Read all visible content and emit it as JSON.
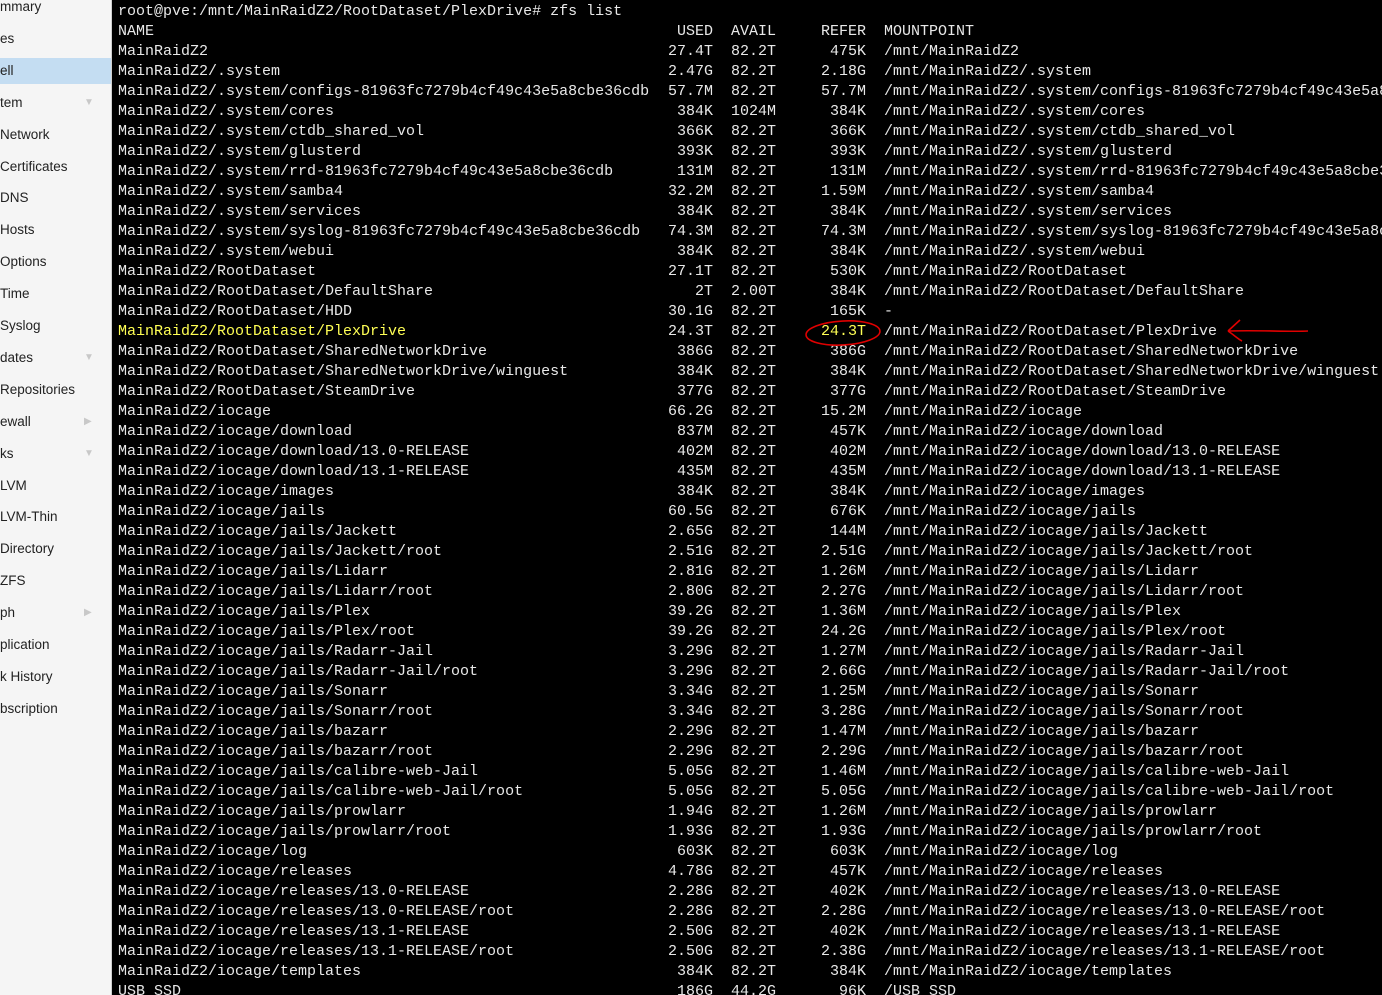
{
  "sidebar": {
    "items": [
      {
        "label": "mmary",
        "arrow": ""
      },
      {
        "label": "es",
        "arrow": ""
      },
      {
        "label": "ell",
        "arrow": "",
        "selected": true
      },
      {
        "label": "tem",
        "arrow": "▼"
      },
      {
        "label": "Network",
        "arrow": ""
      },
      {
        "label": "Certificates",
        "arrow": ""
      },
      {
        "label": "DNS",
        "arrow": ""
      },
      {
        "label": "Hosts",
        "arrow": ""
      },
      {
        "label": "Options",
        "arrow": ""
      },
      {
        "label": "Time",
        "arrow": ""
      },
      {
        "label": "Syslog",
        "arrow": ""
      },
      {
        "label": "dates",
        "arrow": "▼"
      },
      {
        "label": "Repositories",
        "arrow": ""
      },
      {
        "label": "ewall",
        "arrow": "▶"
      },
      {
        "label": "ks",
        "arrow": "▼"
      },
      {
        "label": "LVM",
        "arrow": ""
      },
      {
        "label": "LVM-Thin",
        "arrow": ""
      },
      {
        "label": "Directory",
        "arrow": ""
      },
      {
        "label": "ZFS",
        "arrow": ""
      },
      {
        "label": "ph",
        "arrow": "▶"
      },
      {
        "label": "plication",
        "arrow": ""
      },
      {
        "label": "k History",
        "arrow": ""
      },
      {
        "label": "bscription",
        "arrow": ""
      }
    ]
  },
  "terminal": {
    "prompt": "root@pve:/mnt/MainRaidZ2/RootDataset/PlexDrive# zfs list",
    "headers": {
      "name": "NAME",
      "used": "USED",
      "avail": "AVAIL",
      "refer": "REFER",
      "mount": "MOUNTPOINT"
    },
    "highlight_color": "#ffff55",
    "annotation_color": "#e00000",
    "rows": [
      [
        "MainRaidZ2",
        "27.4T",
        "82.2T",
        "475K",
        "/mnt/MainRaidZ2"
      ],
      [
        "MainRaidZ2/.system",
        "2.47G",
        "82.2T",
        "2.18G",
        "/mnt/MainRaidZ2/.system"
      ],
      [
        "MainRaidZ2/.system/configs-81963fc7279b4cf49c43e5a8cbe36cdb",
        "57.7M",
        "82.2T",
        "57.7M",
        "/mnt/MainRaidZ2/.system/configs-81963fc7279b4cf49c43e5a8"
      ],
      [
        "MainRaidZ2/.system/cores",
        "384K",
        "1024M",
        "384K",
        "/mnt/MainRaidZ2/.system/cores"
      ],
      [
        "MainRaidZ2/.system/ctdb_shared_vol",
        "366K",
        "82.2T",
        "366K",
        "/mnt/MainRaidZ2/.system/ctdb_shared_vol"
      ],
      [
        "MainRaidZ2/.system/glusterd",
        "393K",
        "82.2T",
        "393K",
        "/mnt/MainRaidZ2/.system/glusterd"
      ],
      [
        "MainRaidZ2/.system/rrd-81963fc7279b4cf49c43e5a8cbe36cdb",
        "131M",
        "82.2T",
        "131M",
        "/mnt/MainRaidZ2/.system/rrd-81963fc7279b4cf49c43e5a8cbe3"
      ],
      [
        "MainRaidZ2/.system/samba4",
        "32.2M",
        "82.2T",
        "1.59M",
        "/mnt/MainRaidZ2/.system/samba4"
      ],
      [
        "MainRaidZ2/.system/services",
        "384K",
        "82.2T",
        "384K",
        "/mnt/MainRaidZ2/.system/services"
      ],
      [
        "MainRaidZ2/.system/syslog-81963fc7279b4cf49c43e5a8cbe36cdb",
        "74.3M",
        "82.2T",
        "74.3M",
        "/mnt/MainRaidZ2/.system/syslog-81963fc7279b4cf49c43e5a8c"
      ],
      [
        "MainRaidZ2/.system/webui",
        "384K",
        "82.2T",
        "384K",
        "/mnt/MainRaidZ2/.system/webui"
      ],
      [
        "MainRaidZ2/RootDataset",
        "27.1T",
        "82.2T",
        "530K",
        "/mnt/MainRaidZ2/RootDataset"
      ],
      [
        "MainRaidZ2/RootDataset/DefaultShare",
        "2T",
        "2.00T",
        "384K",
        "/mnt/MainRaidZ2/RootDataset/DefaultShare"
      ],
      [
        "MainRaidZ2/RootDataset/HDD",
        "30.1G",
        "82.2T",
        "165K",
        "-"
      ],
      [
        "MainRaidZ2/RootDataset/PlexDrive",
        "24.3T",
        "82.2T",
        "24.3T",
        "/mnt/MainRaidZ2/RootDataset/PlexDrive"
      ],
      [
        "MainRaidZ2/RootDataset/SharedNetworkDrive",
        "386G",
        "82.2T",
        "386G",
        "/mnt/MainRaidZ2/RootDataset/SharedNetworkDrive"
      ],
      [
        "MainRaidZ2/RootDataset/SharedNetworkDrive/winguest",
        "384K",
        "82.2T",
        "384K",
        "/mnt/MainRaidZ2/RootDataset/SharedNetworkDrive/winguest"
      ],
      [
        "MainRaidZ2/RootDataset/SteamDrive",
        "377G",
        "82.2T",
        "377G",
        "/mnt/MainRaidZ2/RootDataset/SteamDrive"
      ],
      [
        "MainRaidZ2/iocage",
        "66.2G",
        "82.2T",
        "15.2M",
        "/mnt/MainRaidZ2/iocage"
      ],
      [
        "MainRaidZ2/iocage/download",
        "837M",
        "82.2T",
        "457K",
        "/mnt/MainRaidZ2/iocage/download"
      ],
      [
        "MainRaidZ2/iocage/download/13.0-RELEASE",
        "402M",
        "82.2T",
        "402M",
        "/mnt/MainRaidZ2/iocage/download/13.0-RELEASE"
      ],
      [
        "MainRaidZ2/iocage/download/13.1-RELEASE",
        "435M",
        "82.2T",
        "435M",
        "/mnt/MainRaidZ2/iocage/download/13.1-RELEASE"
      ],
      [
        "MainRaidZ2/iocage/images",
        "384K",
        "82.2T",
        "384K",
        "/mnt/MainRaidZ2/iocage/images"
      ],
      [
        "MainRaidZ2/iocage/jails",
        "60.5G",
        "82.2T",
        "676K",
        "/mnt/MainRaidZ2/iocage/jails"
      ],
      [
        "MainRaidZ2/iocage/jails/Jackett",
        "2.65G",
        "82.2T",
        "144M",
        "/mnt/MainRaidZ2/iocage/jails/Jackett"
      ],
      [
        "MainRaidZ2/iocage/jails/Jackett/root",
        "2.51G",
        "82.2T",
        "2.51G",
        "/mnt/MainRaidZ2/iocage/jails/Jackett/root"
      ],
      [
        "MainRaidZ2/iocage/jails/Lidarr",
        "2.81G",
        "82.2T",
        "1.26M",
        "/mnt/MainRaidZ2/iocage/jails/Lidarr"
      ],
      [
        "MainRaidZ2/iocage/jails/Lidarr/root",
        "2.80G",
        "82.2T",
        "2.27G",
        "/mnt/MainRaidZ2/iocage/jails/Lidarr/root"
      ],
      [
        "MainRaidZ2/iocage/jails/Plex",
        "39.2G",
        "82.2T",
        "1.36M",
        "/mnt/MainRaidZ2/iocage/jails/Plex"
      ],
      [
        "MainRaidZ2/iocage/jails/Plex/root",
        "39.2G",
        "82.2T",
        "24.2G",
        "/mnt/MainRaidZ2/iocage/jails/Plex/root"
      ],
      [
        "MainRaidZ2/iocage/jails/Radarr-Jail",
        "3.29G",
        "82.2T",
        "1.27M",
        "/mnt/MainRaidZ2/iocage/jails/Radarr-Jail"
      ],
      [
        "MainRaidZ2/iocage/jails/Radarr-Jail/root",
        "3.29G",
        "82.2T",
        "2.66G",
        "/mnt/MainRaidZ2/iocage/jails/Radarr-Jail/root"
      ],
      [
        "MainRaidZ2/iocage/jails/Sonarr",
        "3.34G",
        "82.2T",
        "1.25M",
        "/mnt/MainRaidZ2/iocage/jails/Sonarr"
      ],
      [
        "MainRaidZ2/iocage/jails/Sonarr/root",
        "3.34G",
        "82.2T",
        "3.28G",
        "/mnt/MainRaidZ2/iocage/jails/Sonarr/root"
      ],
      [
        "MainRaidZ2/iocage/jails/bazarr",
        "2.29G",
        "82.2T",
        "1.47M",
        "/mnt/MainRaidZ2/iocage/jails/bazarr"
      ],
      [
        "MainRaidZ2/iocage/jails/bazarr/root",
        "2.29G",
        "82.2T",
        "2.29G",
        "/mnt/MainRaidZ2/iocage/jails/bazarr/root"
      ],
      [
        "MainRaidZ2/iocage/jails/calibre-web-Jail",
        "5.05G",
        "82.2T",
        "1.46M",
        "/mnt/MainRaidZ2/iocage/jails/calibre-web-Jail"
      ],
      [
        "MainRaidZ2/iocage/jails/calibre-web-Jail/root",
        "5.05G",
        "82.2T",
        "5.05G",
        "/mnt/MainRaidZ2/iocage/jails/calibre-web-Jail/root"
      ],
      [
        "MainRaidZ2/iocage/jails/prowlarr",
        "1.94G",
        "82.2T",
        "1.26M",
        "/mnt/MainRaidZ2/iocage/jails/prowlarr"
      ],
      [
        "MainRaidZ2/iocage/jails/prowlarr/root",
        "1.93G",
        "82.2T",
        "1.93G",
        "/mnt/MainRaidZ2/iocage/jails/prowlarr/root"
      ],
      [
        "MainRaidZ2/iocage/log",
        "603K",
        "82.2T",
        "603K",
        "/mnt/MainRaidZ2/iocage/log"
      ],
      [
        "MainRaidZ2/iocage/releases",
        "4.78G",
        "82.2T",
        "457K",
        "/mnt/MainRaidZ2/iocage/releases"
      ],
      [
        "MainRaidZ2/iocage/releases/13.0-RELEASE",
        "2.28G",
        "82.2T",
        "402K",
        "/mnt/MainRaidZ2/iocage/releases/13.0-RELEASE"
      ],
      [
        "MainRaidZ2/iocage/releases/13.0-RELEASE/root",
        "2.28G",
        "82.2T",
        "2.28G",
        "/mnt/MainRaidZ2/iocage/releases/13.0-RELEASE/root"
      ],
      [
        "MainRaidZ2/iocage/releases/13.1-RELEASE",
        "2.50G",
        "82.2T",
        "402K",
        "/mnt/MainRaidZ2/iocage/releases/13.1-RELEASE"
      ],
      [
        "MainRaidZ2/iocage/releases/13.1-RELEASE/root",
        "2.50G",
        "82.2T",
        "2.38G",
        "/mnt/MainRaidZ2/iocage/releases/13.1-RELEASE/root"
      ],
      [
        "MainRaidZ2/iocage/templates",
        "384K",
        "82.2T",
        "384K",
        "/mnt/MainRaidZ2/iocage/templates"
      ],
      [
        "USB_SSD",
        "186G",
        "44.2G",
        "96K",
        "/USB_SSD"
      ]
    ],
    "highlighted_row": 14
  }
}
